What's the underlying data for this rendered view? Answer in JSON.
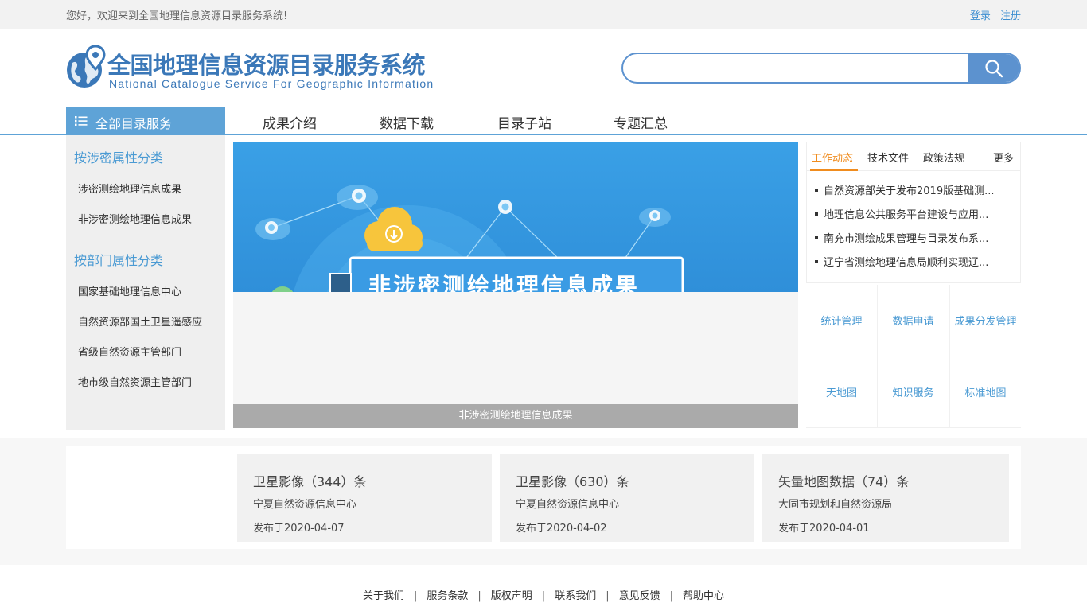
{
  "topbar": {
    "welcome": "您好，欢迎来到全国地理信息资源目录服务系统!",
    "login": "登录",
    "register": "注册"
  },
  "header": {
    "title": "全国地理信息资源目录服务系统",
    "subtitle": "National Catalogue Service For Geographic Information",
    "search_placeholder": "",
    "search_icon": "search-icon"
  },
  "nav": {
    "all_label": "全部目录服务",
    "items": [
      "成果介绍",
      "数据下载",
      "目录子站",
      "专题汇总"
    ]
  },
  "sidebar": {
    "cat1": "按涉密属性分类",
    "cat1_items": [
      "涉密测绘地理信息成果",
      "非涉密测绘地理信息成果"
    ],
    "cat2": "按部门属性分类",
    "cat2_items": [
      "国家基础地理信息中心",
      "自然资源部国土卫星遥感应",
      "省级自然资源主管部门",
      "地市级自然资源主管部门"
    ]
  },
  "banner": {
    "headline": "非涉密测绘地理信息成果",
    "caption": "非涉密测绘地理信息成果"
  },
  "news": {
    "tabs": [
      "工作动态",
      "技术文件",
      "政策法规"
    ],
    "active_tab": "工作动态",
    "more": "更多",
    "items": [
      "自然资源部关于发布2019版基础测...",
      "地理信息公共服务平台建设与应用...",
      "南充市测绘成果管理与目录发布系...",
      "辽宁省测绘地理信息局顺利实现辽..."
    ]
  },
  "quick": [
    "统计管理",
    "数据申请",
    "成果分发管理",
    "天地图",
    "知识服务",
    "标准地图"
  ],
  "cards": [
    {
      "title": "卫星影像（344）条",
      "org": "宁夏自然资源信息中心",
      "date": "发布于2020-04-07"
    },
    {
      "title": "卫星影像（630）条",
      "org": "宁夏自然资源信息中心",
      "date": "发布于2020-04-02"
    },
    {
      "title": "矢量地图数据（74）条",
      "org": "大同市规划和自然资源局",
      "date": "发布于2020-04-01"
    }
  ],
  "footer": [
    "关于我们",
    "服务条款",
    "版权声明",
    "联系我们",
    "意见反馈",
    "帮助中心"
  ],
  "colors": {
    "brand": "#3b78b8",
    "accent": "#5ea3d7",
    "active_tab": "#f08c1e"
  }
}
